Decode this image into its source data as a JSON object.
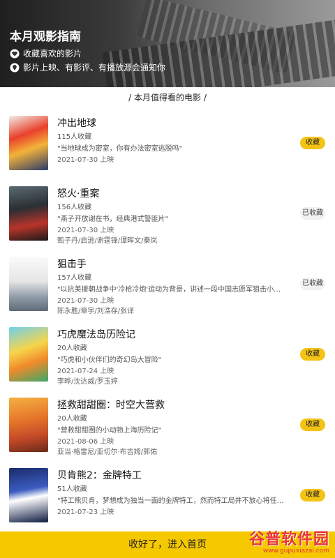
{
  "header": {
    "title": "本月观影指南",
    "line1": "收藏喜欢的影片",
    "line2": "影片上映、有影评、有播放源会通知你"
  },
  "section_title": "/     本月值得看的电影     /",
  "movies": [
    {
      "title": "冲出地球",
      "count": "115人收藏",
      "desc": "\"当地球成为密室，你有办法密室逃脱吗\"",
      "date": "2021-07-30 上映",
      "cast": "",
      "button": "收藏",
      "state": "yellow"
    },
    {
      "title": "怒火·重案",
      "count": "156人收藏",
      "desc": "\"燕子开放谢在书，经典港式警匪片\"",
      "date": "2021-07-30 上映",
      "cast": "甄子丹/启逊/谢霆锋/谭晖文/秦岚",
      "button": "已收藏",
      "state": "grey"
    },
    {
      "title": "狙击手",
      "count": "157人收藏",
      "desc": "\"以抗美援朝战争中'冷枪冷炮'运动为背景，讲述一段中国志愿军狙击小队与美军...",
      "date": "2021-07-30 上映",
      "cast": "陈永胜/章宇/刘浩存/张译",
      "button": "已收藏",
      "state": "grey"
    },
    {
      "title": "巧虎魔法岛历险记",
      "count": "20人收藏",
      "desc": "\"巧虎和小伙伴们的奇幻岛大冒险\"",
      "date": "2021-07-24 上映",
      "cast": "李晔/沈达威/罗玉婷",
      "button": "收藏",
      "state": "yellow"
    },
    {
      "title": "拯救甜甜圈：时空大营救",
      "count": "20人收藏",
      "desc": "\"营救甜甜圈的小动物上海历险记\"",
      "date": "2021-08-06 上映",
      "cast": "亚当·格雷尼/亚切尔·布吉姆/郭佑",
      "button": "收藏",
      "state": "yellow"
    },
    {
      "title": "贝肯熊2：金牌特工",
      "count": "51人收藏",
      "desc": "\"特工熊贝肯，梦想成为独当一面的金牌特工，然而特工局并不放心将任务交给一...",
      "date": "2021-07-23 上映",
      "cast": "",
      "button": "收藏",
      "state": "yellow"
    }
  ],
  "bottom_button": "收好了，进入首页",
  "watermark": {
    "name": "谷普软件园",
    "url": "www.gupuxiazai.com"
  },
  "colors": {
    "accent": "#f5c800",
    "button_yellow": "#f3c316",
    "button_grey": "#f1f1f1"
  }
}
